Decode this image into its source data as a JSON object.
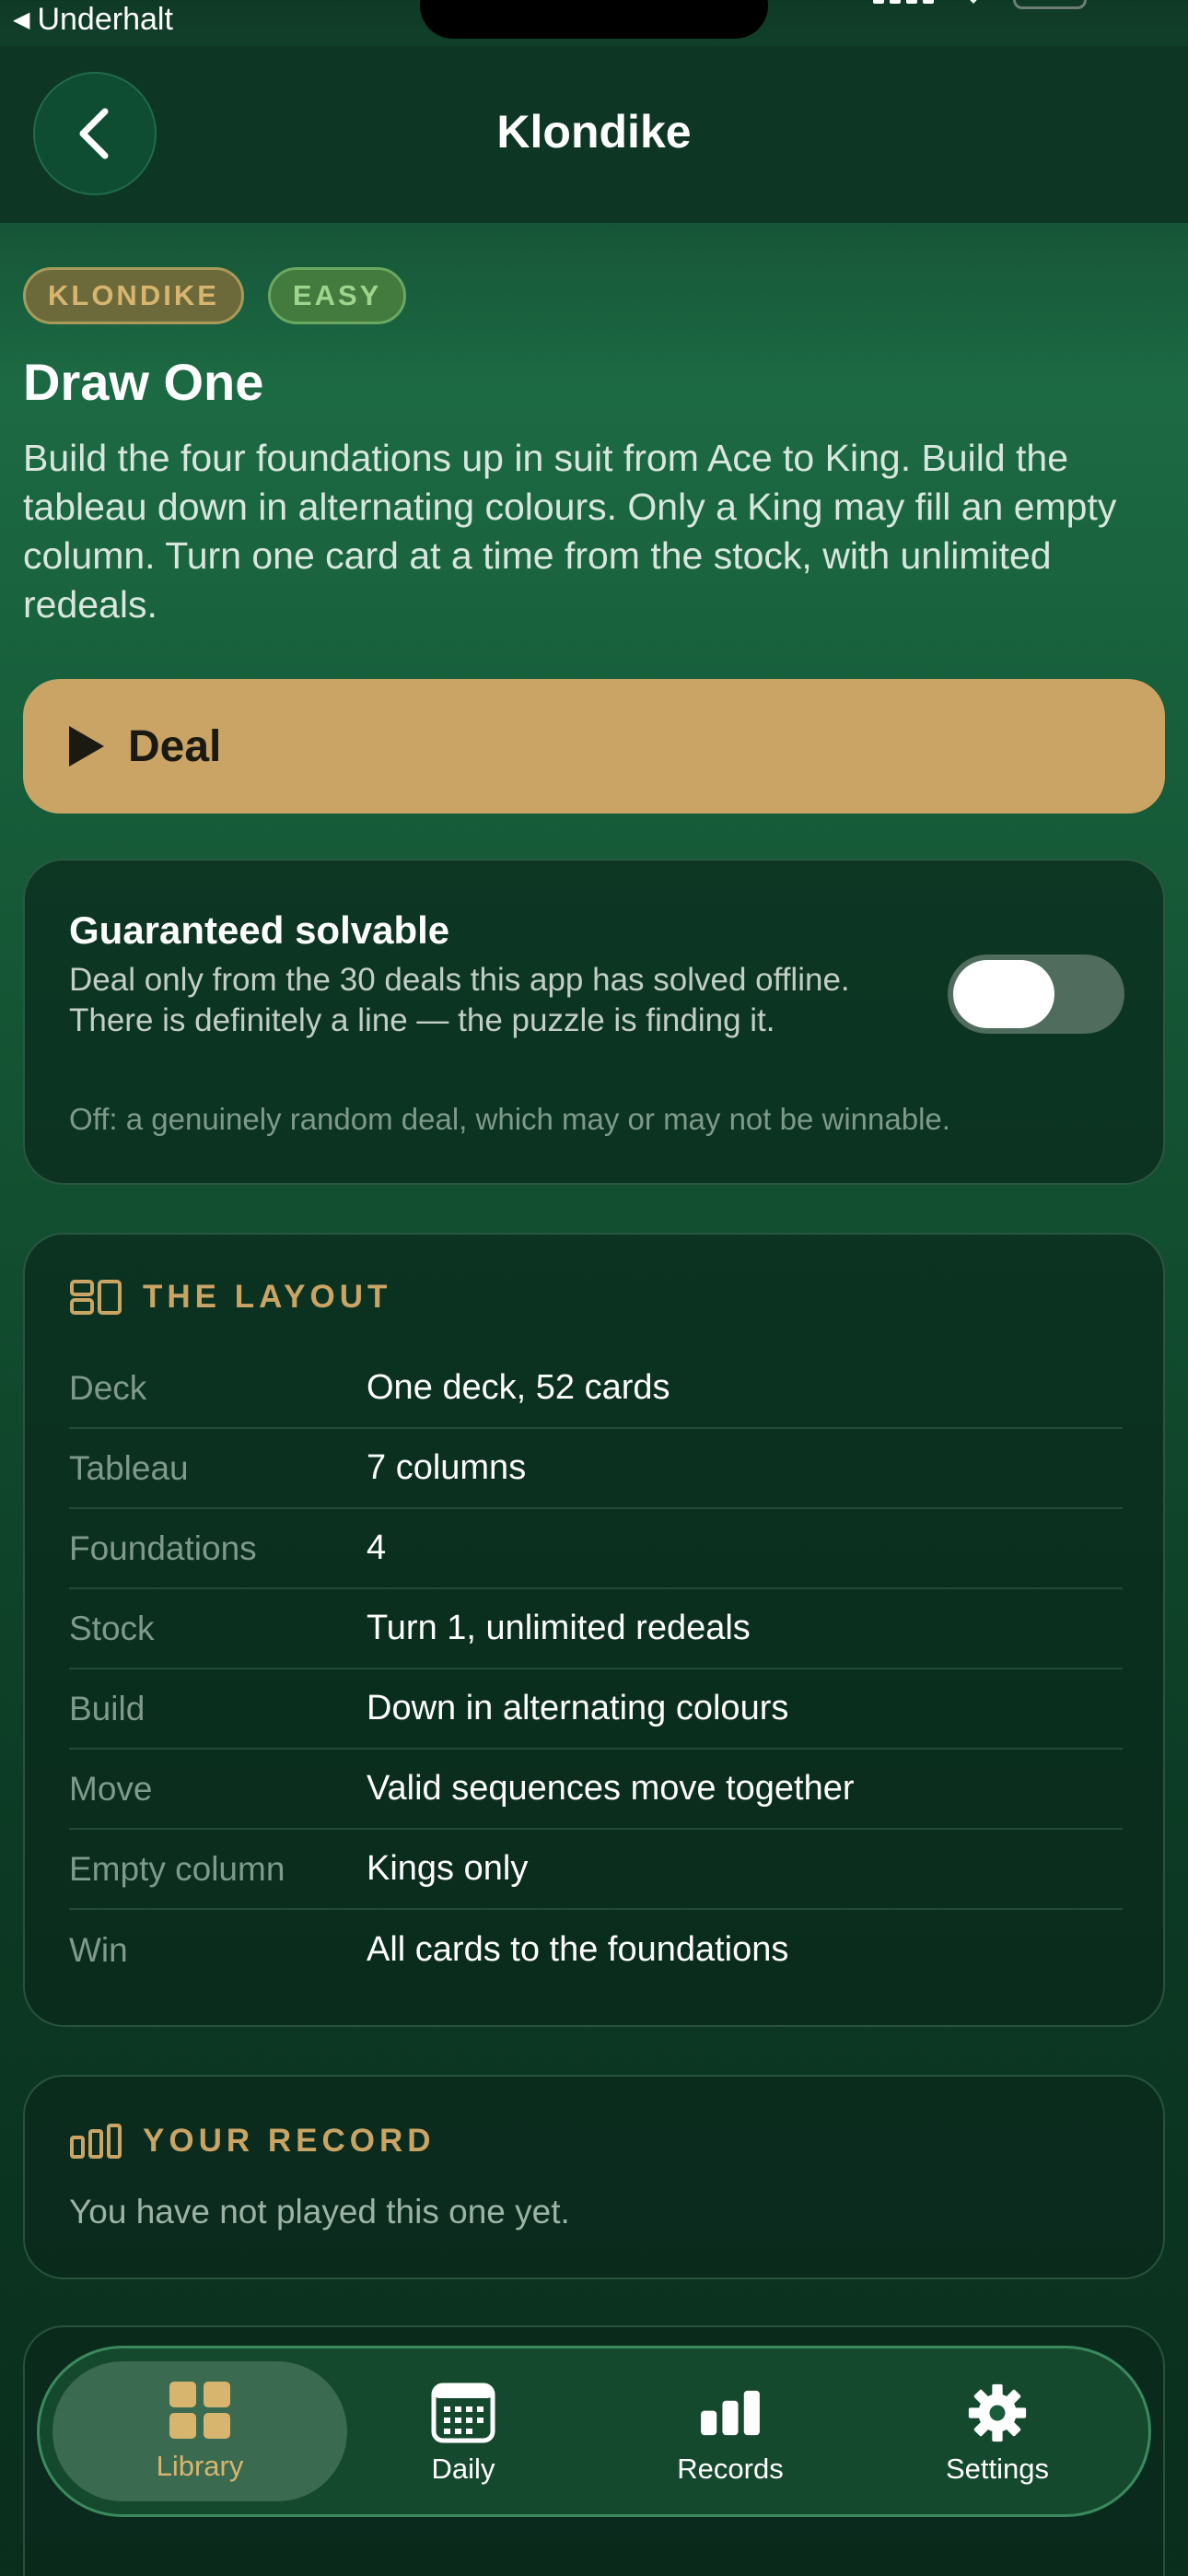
{
  "status_bar": {
    "back_app": "Underhalt"
  },
  "nav": {
    "title": "Klondike"
  },
  "tags": {
    "klondike": "KLONDIKE",
    "easy": "EASY"
  },
  "mode": {
    "title": "Draw One",
    "description": "Build the four foundations up in suit from Ace to King. Build the tableau down in alternating colours. Only a King may fill an empty column. Turn one card at a time from the stock, with unlimited redeals."
  },
  "deal_button": {
    "label": "Deal"
  },
  "solvable": {
    "title": "Guaranteed solvable",
    "description": "Deal only from the 30 deals this app has solved offline. There is definitely a line — the puzzle is finding it.",
    "off_note": "Off: a genuinely random deal, which may or may not be winnable.",
    "toggle_on": false
  },
  "layout": {
    "title": "THE LAYOUT",
    "rows": [
      {
        "key": "Deck",
        "value": "One deck, 52 cards"
      },
      {
        "key": "Tableau",
        "value": "7 columns"
      },
      {
        "key": "Foundations",
        "value": "4"
      },
      {
        "key": "Stock",
        "value": "Turn 1, unlimited redeals"
      },
      {
        "key": "Build",
        "value": "Down in alternating colours"
      },
      {
        "key": "Move",
        "value": "Valid sequences move together"
      },
      {
        "key": "Empty column",
        "value": "Kings only"
      },
      {
        "key": "Win",
        "value": "All cards to the foundations"
      }
    ]
  },
  "record": {
    "title": "YOUR RECORD",
    "text": "You have not played this one yet."
  },
  "tab_bar": {
    "library": "Library",
    "daily": "Daily",
    "records": "Records",
    "settings": "Settings"
  },
  "colors": {
    "accent_gold": "#c9a464",
    "background_green": "#1c6a44"
  }
}
